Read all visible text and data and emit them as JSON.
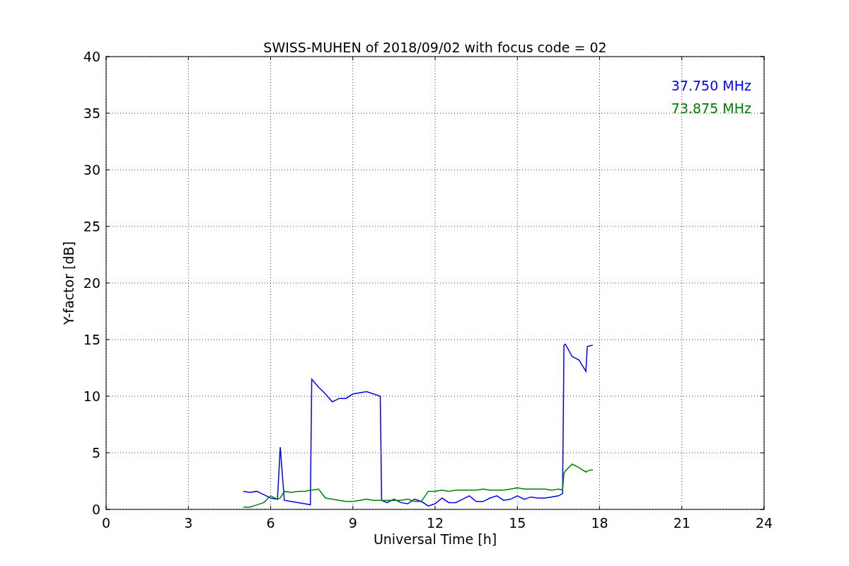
{
  "figure": {
    "chart_data": {
      "type": "line",
      "title": "SWISS-MUHEN of 2018/09/02 with focus code = 02",
      "xlabel": "Universal Time [h]",
      "ylabel": "Y-factor [dB]",
      "x": [
        5.0,
        5.25,
        5.5,
        5.75,
        6.0,
        6.25,
        6.35,
        6.5,
        6.75,
        7.0,
        7.25,
        7.45,
        7.5,
        7.75,
        8.0,
        8.25,
        8.5,
        8.75,
        9.0,
        9.25,
        9.5,
        9.75,
        10.0,
        10.05,
        10.25,
        10.5,
        10.75,
        11.0,
        11.25,
        11.5,
        11.75,
        12.0,
        12.25,
        12.5,
        12.75,
        13.0,
        13.25,
        13.5,
        13.75,
        14.0,
        14.25,
        14.5,
        14.75,
        15.0,
        15.25,
        15.5,
        15.75,
        16.0,
        16.25,
        16.5,
        16.65,
        16.7,
        16.75,
        17.0,
        17.25,
        17.5,
        17.55,
        17.75
      ],
      "series": [
        {
          "name": "37.750 MHz",
          "color": "#0000ff",
          "values": [
            1.6,
            1.5,
            1.6,
            1.3,
            1.0,
            0.9,
            5.5,
            0.8,
            0.7,
            0.6,
            0.5,
            0.4,
            11.5,
            10.8,
            10.2,
            9.5,
            9.8,
            9.8,
            10.2,
            10.3,
            10.4,
            10.2,
            10.0,
            0.8,
            0.6,
            0.9,
            0.6,
            0.5,
            0.9,
            0.7,
            0.3,
            0.5,
            1.0,
            0.6,
            0.6,
            0.9,
            1.2,
            0.7,
            0.7,
            1.0,
            1.2,
            0.8,
            0.9,
            1.2,
            0.9,
            1.1,
            1.0,
            1.0,
            1.1,
            1.2,
            1.4,
            14.5,
            14.6,
            13.5,
            13.2,
            12.2,
            14.4,
            14.5
          ]
        },
        {
          "name": "73.875 MHz",
          "color": "#008000",
          "values": [
            0.2,
            0.2,
            0.4,
            0.6,
            1.2,
            0.9,
            1.0,
            1.6,
            1.5,
            1.6,
            1.6,
            1.7,
            1.7,
            1.8,
            1.0,
            0.9,
            0.8,
            0.7,
            0.7,
            0.8,
            0.9,
            0.8,
            0.8,
            0.8,
            0.8,
            0.8,
            0.8,
            0.9,
            0.7,
            0.7,
            1.6,
            1.6,
            1.7,
            1.6,
            1.7,
            1.7,
            1.7,
            1.7,
            1.8,
            1.7,
            1.7,
            1.7,
            1.8,
            1.9,
            1.8,
            1.8,
            1.8,
            1.8,
            1.7,
            1.8,
            1.7,
            3.2,
            3.4,
            4.0,
            3.7,
            3.3,
            3.4,
            3.5
          ]
        }
      ],
      "grid": true,
      "xlim": [
        0,
        24
      ],
      "ylim": [
        0,
        40
      ],
      "xticks": [
        0,
        3,
        6,
        9,
        12,
        15,
        18,
        21,
        24
      ],
      "yticks": [
        0,
        5,
        10,
        15,
        20,
        25,
        30,
        35,
        40
      ]
    }
  }
}
